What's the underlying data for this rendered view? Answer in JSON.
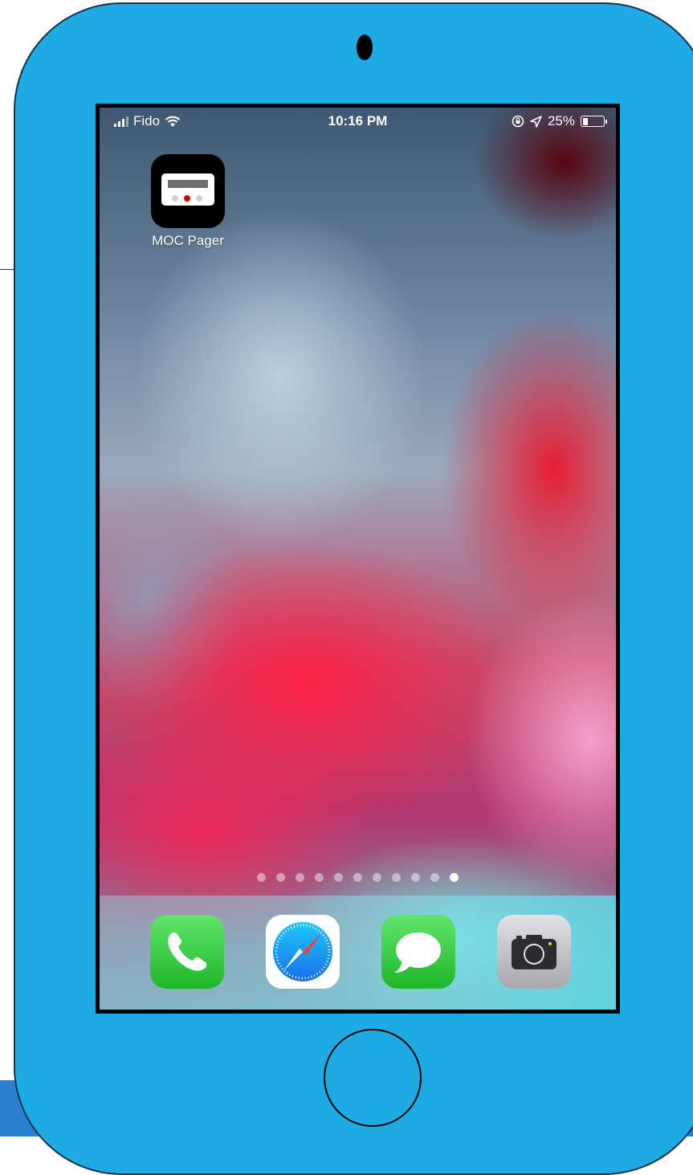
{
  "status_bar": {
    "carrier": "Fido",
    "time": "10:16 PM",
    "battery_percent": "25%",
    "battery_level": 0.25,
    "icons": [
      "signal-bars",
      "wifi",
      "orientation-lock",
      "location-arrow",
      "battery"
    ]
  },
  "home_screen": {
    "apps": [
      {
        "label": "MOC Pager",
        "icon": "pager-icon"
      }
    ]
  },
  "page_indicator": {
    "count": 11,
    "active_index": 10
  },
  "dock": {
    "apps": [
      {
        "icon": "phone-icon"
      },
      {
        "icon": "safari-icon"
      },
      {
        "icon": "messages-icon"
      },
      {
        "icon": "camera-icon"
      }
    ]
  },
  "colors": {
    "device_body": "#1eaae3",
    "bottom_strip": "#2b7fd0",
    "pager_red_light": "#d00000"
  }
}
